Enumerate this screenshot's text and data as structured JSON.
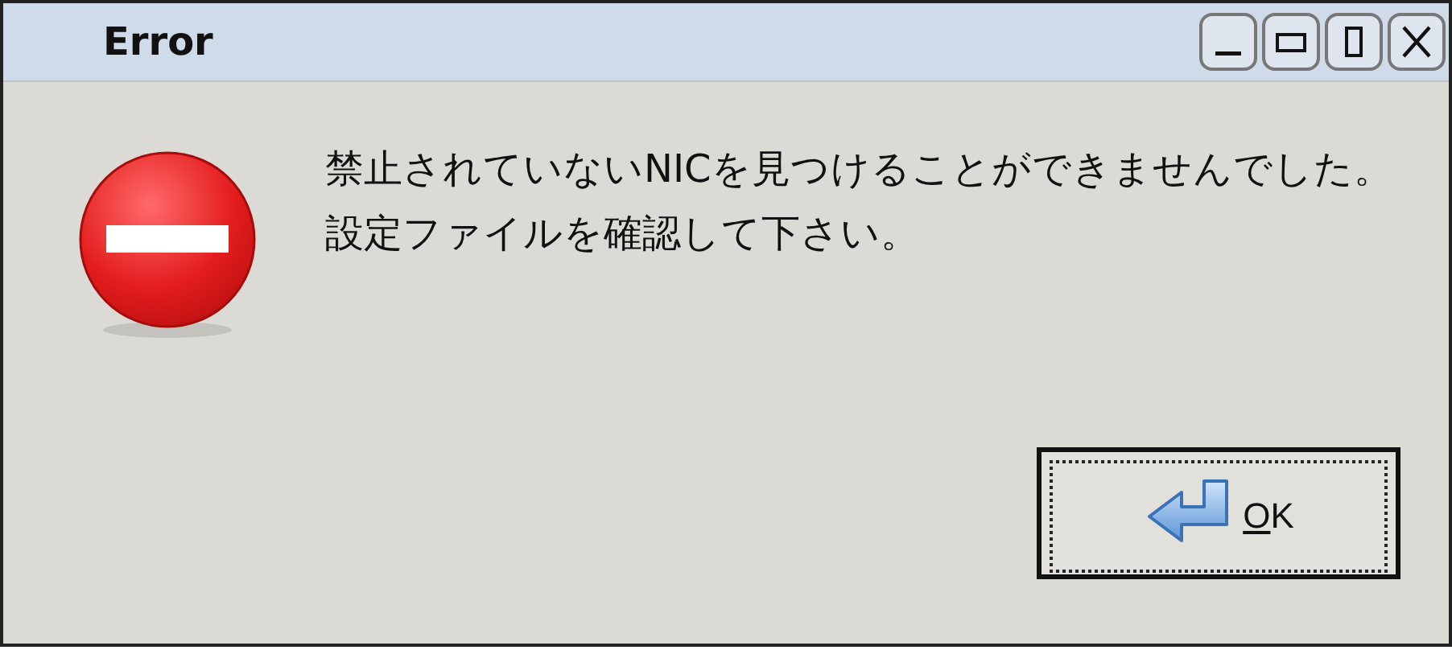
{
  "window": {
    "title": "Error"
  },
  "message": "禁止されていないNICを見つけることができませんでした。設定ファイルを確認して下さい。",
  "buttons": [
    {
      "label": "OK",
      "focused": true
    }
  ]
}
